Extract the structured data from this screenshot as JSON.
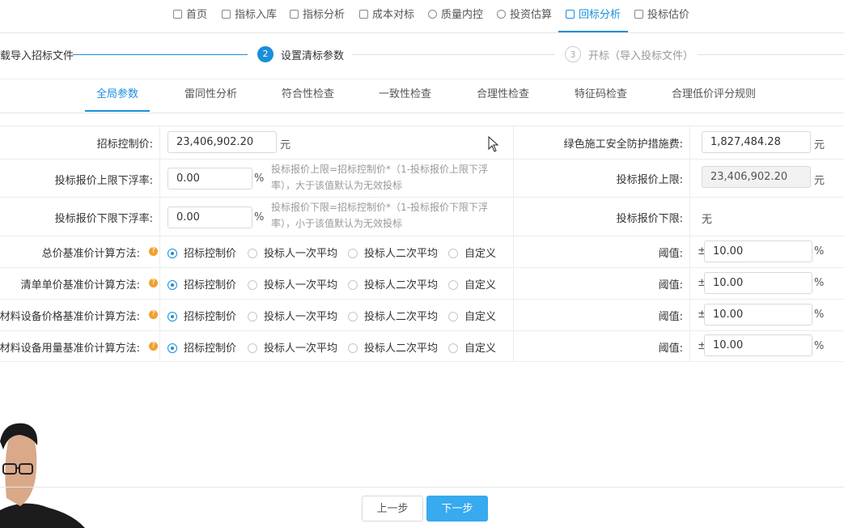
{
  "nav": {
    "items": [
      {
        "label": "首页",
        "icon": "home-icon"
      },
      {
        "label": "指标入库",
        "icon": "download-icon"
      },
      {
        "label": "指标分析",
        "icon": "bar-chart-icon"
      },
      {
        "label": "成本对标",
        "icon": "grid-icon"
      },
      {
        "label": "质量内控",
        "icon": "search-icon"
      },
      {
        "label": "投资估算",
        "icon": "coin-icon"
      },
      {
        "label": "回标分析",
        "icon": "square-icon"
      },
      {
        "label": "投标估价",
        "icon": "box-icon"
      }
    ],
    "active": "回标分析"
  },
  "steps": {
    "step1": "载导入招标文件",
    "step2_num": "2",
    "step2": "设置清标参数",
    "step3_num": "3",
    "step3": "开标（导入投标文件）"
  },
  "tabs": {
    "items": [
      "全局参数",
      "雷同性分析",
      "符合性检查",
      "一致性检查",
      "合理性检查",
      "特征码检查",
      "合理低价评分规则"
    ],
    "active": "全局参数"
  },
  "form": {
    "control_price_label": "招标控制价:",
    "control_price_value": "23,406,902.20",
    "yuan": "元",
    "green_fee_label": "绿色施工安全防护措施费:",
    "green_fee_value": "1,827,484.28",
    "upper_float_label": "投标报价上限下浮率:",
    "upper_float_value": "0.00",
    "percent": "%",
    "upper_hint_1": "投标报价上限=招标控制价*（1-投标报价上限下浮",
    "upper_hint_2": "率），大于该值默认为无效投标",
    "upper_limit_label": "投标报价上限:",
    "upper_limit_value": "23,406,902.20",
    "lower_float_label": "投标报价下限下浮率:",
    "lower_float_value": "0.00",
    "lower_hint_1": "投标报价下限=招标控制价*（1-投标报价下限下浮",
    "lower_hint_2": "率），小于该值默认为无效投标",
    "lower_limit_label": "投标报价下限:",
    "lower_limit_value": "无",
    "help_symbol": "?",
    "pm": "±",
    "threshold_label": "阈值:",
    "radio_options": [
      "招标控制价",
      "投标人一次平均",
      "投标人二次平均",
      "自定义"
    ],
    "methods": [
      {
        "label": "总价基准价计算方法:",
        "selected": "招标控制价",
        "threshold": "10.00"
      },
      {
        "label": "清单单价基准价计算方法:",
        "selected": "招标控制价",
        "threshold": "10.00"
      },
      {
        "label": "材料设备价格基准价计算方法:",
        "selected": "招标控制价",
        "threshold": "10.00"
      },
      {
        "label": "材料设备用量基准价计算方法:",
        "selected": "招标控制价",
        "threshold": "10.00"
      }
    ]
  },
  "footer": {
    "prev_label": "上一步",
    "next_label": "下一步"
  },
  "colors": {
    "accent": "#1a8fd9",
    "button_primary": "#37aaf0",
    "help_badge": "#f0a030"
  }
}
